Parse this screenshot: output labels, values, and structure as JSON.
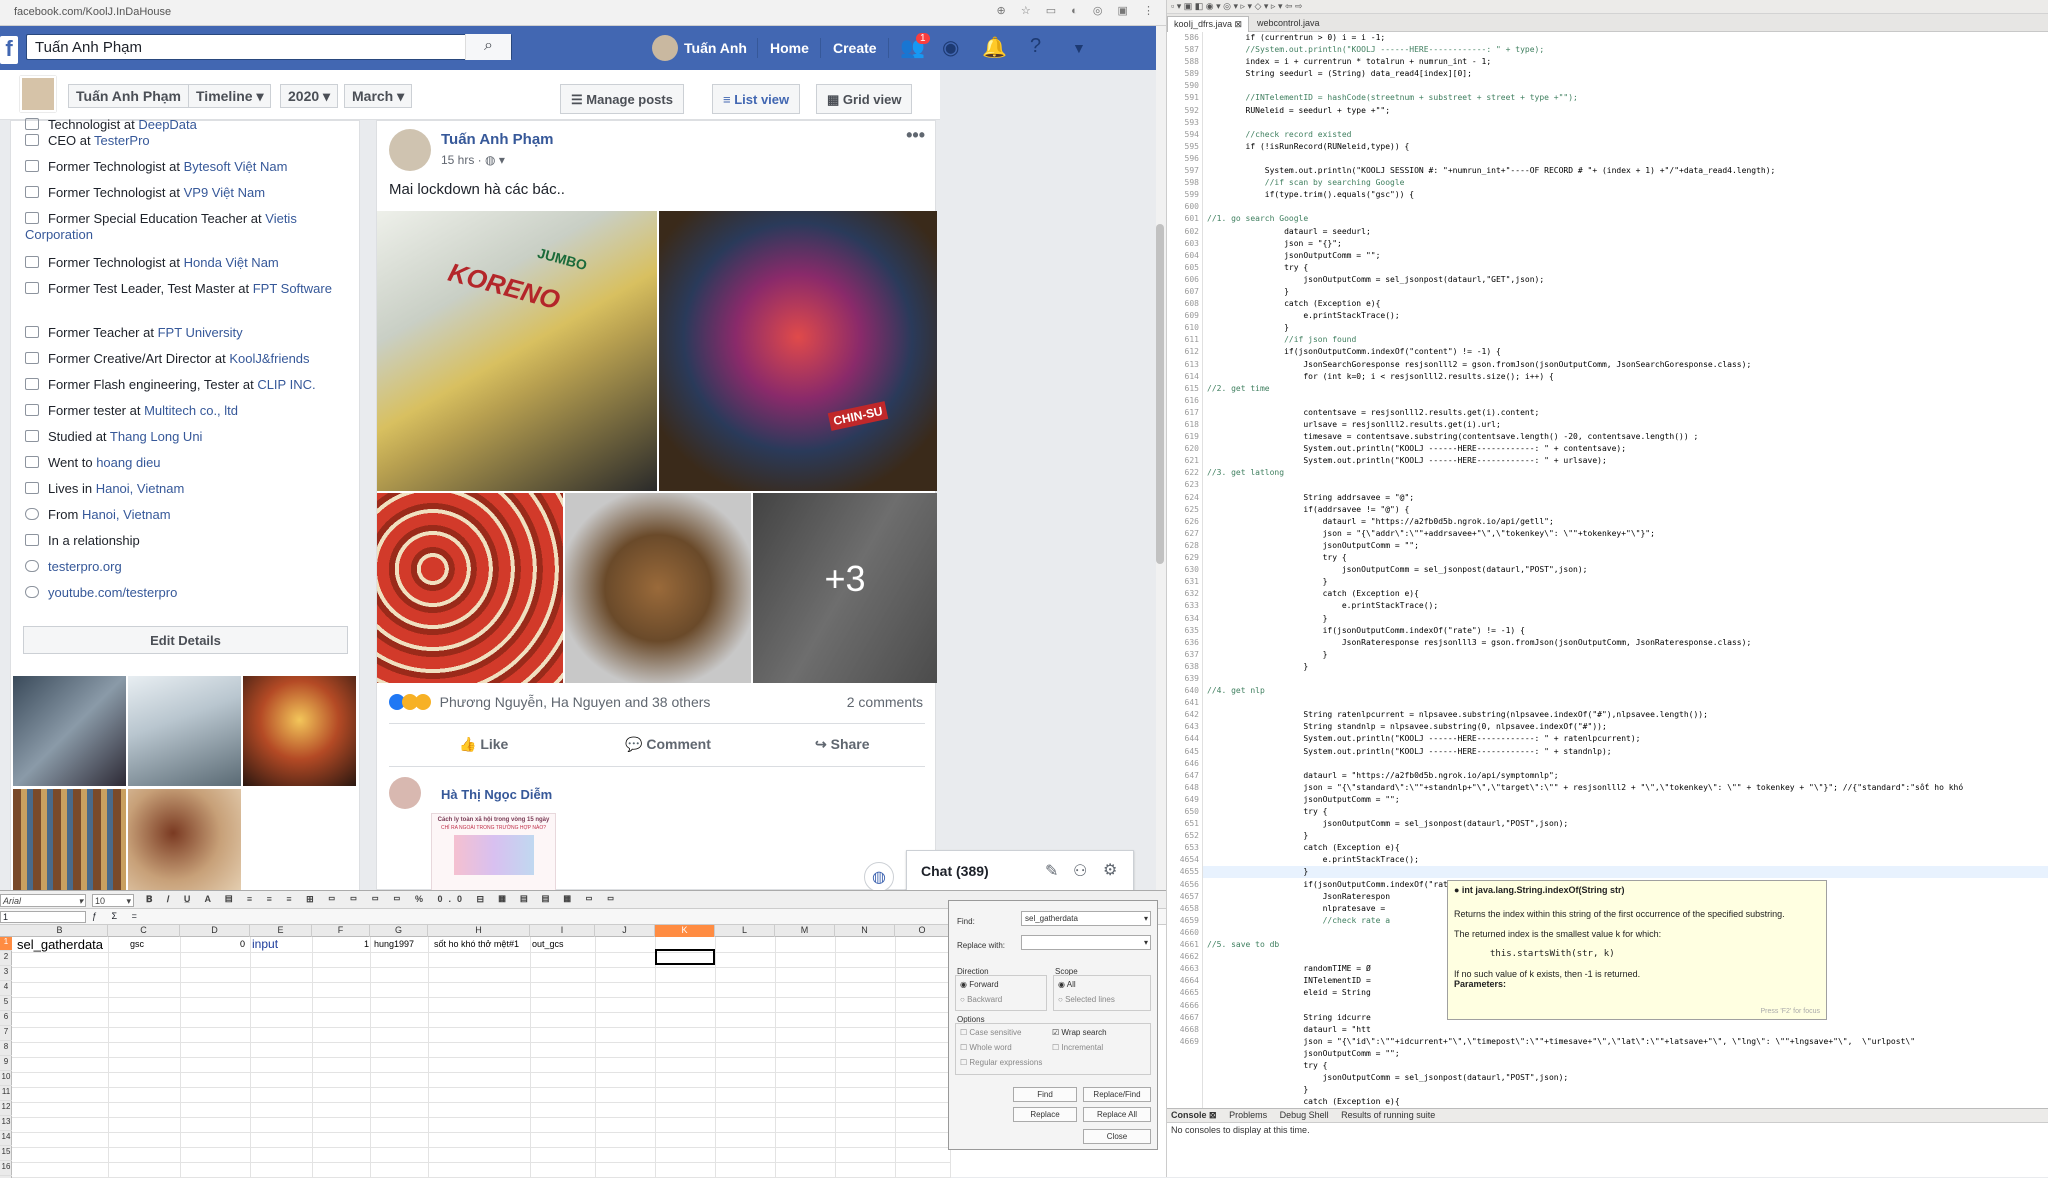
{
  "browser": {
    "url": "facebook.com/KoolJ.InDaHouse"
  },
  "topnav": {
    "search_value": "Tuấn Anh Phạm",
    "profile_name": "Tuấn Anh",
    "home": "Home",
    "create": "Create",
    "friend_badge": "1",
    "brand_color": "#4267b2"
  },
  "timeline_bar": {
    "name": "Tuấn Anh Phạm",
    "timeline": "Timeline",
    "year": "2020",
    "month": "March",
    "manage_posts": "Manage posts",
    "list_view": "List view",
    "grid_view": "Grid view"
  },
  "intro": {
    "cut_top": {
      "prefix": "Technologist at ",
      "link": "DeepData"
    },
    "items": [
      {
        "icon": "briefcase-icon",
        "prefix": "CEO at ",
        "link": "TesterPro"
      },
      {
        "icon": "briefcase-icon",
        "prefix": "Former Technologist at ",
        "link": "Bytesoft Việt Nam"
      },
      {
        "icon": "briefcase-icon",
        "prefix": "Former Technologist at ",
        "link": "VP9 Việt Nam"
      },
      {
        "icon": "briefcase-icon",
        "prefix": "Former Special Education Teacher at ",
        "link": "Vietis Corporation"
      },
      {
        "icon": "briefcase-icon",
        "prefix": "Former Technologist at ",
        "link": "Honda Việt Nam"
      },
      {
        "icon": "briefcase-icon",
        "prefix": "Former Test Leader, Test Master at ",
        "link": "FPT Software"
      },
      {
        "icon": "briefcase-icon",
        "prefix": "Former Teacher at ",
        "link": "FPT University"
      },
      {
        "icon": "briefcase-icon",
        "prefix": "Former Creative/Art Director at ",
        "link": "KoolJ&friends"
      },
      {
        "icon": "briefcase-icon",
        "prefix": "Former Flash engineering, Tester at ",
        "link": "CLIP INC."
      },
      {
        "icon": "briefcase-icon",
        "prefix": "Former tester at ",
        "link": "Multitech co., ltd"
      },
      {
        "icon": "graduation-cap-icon",
        "prefix": "Studied at ",
        "link": "Thang Long Uni"
      },
      {
        "icon": "graduation-cap-icon",
        "prefix": "Went to ",
        "link": "hoang dieu"
      },
      {
        "icon": "home-icon",
        "prefix": "Lives in ",
        "link": "Hanoi, Vietnam"
      },
      {
        "icon": "location-pin-icon",
        "prefix": "From ",
        "link": "Hanoi, Vietnam"
      },
      {
        "icon": "heart-icon",
        "prefix": "In a relationship",
        "link": ""
      },
      {
        "icon": "globe-icon",
        "prefix": "",
        "link": "testerpro.org"
      },
      {
        "icon": "globe-icon",
        "prefix": "",
        "link": "youtube.com/testerpro"
      }
    ],
    "edit_details": "Edit Details"
  },
  "post": {
    "author": "Tuấn Anh Phạm",
    "time": "15 hrs · ",
    "text": "Mai lockdown hà các bác..",
    "more_photos": "+3",
    "reactions": "Phương Nguyễn, Ha Nguyen and 38 others",
    "comments": "2 comments",
    "like": "Like",
    "comment": "Comment",
    "share": "Share",
    "comment_author": "Hà Thị Ngọc Diễm",
    "comment_card_title": "Cách ly toàn xã hội trong vòng 15 ngày",
    "comment_card_sub": "CHỈ RA NGOÀI TRONG TRƯỜNG HỢP NÀO?",
    "photo_labels": [
      "JUMBO",
      "KORENO",
      "CHIN-SU"
    ]
  },
  "chat": {
    "label": "Chat (389)"
  },
  "ide": {
    "toolbar": "▫ ▾ ▣ ◧ ◉ ▾ ◎ ▾ ▹ ▾ ◇ ▾ ▹ ▾ ⇦ ⇨",
    "tabs": [
      "kooIj_dfrs.java ⊠",
      "webcontrol.java"
    ],
    "line_numbers": [
      "586",
      "587",
      "588",
      "589",
      "590",
      "591",
      "592",
      "593",
      "594",
      "595",
      "596",
      "597",
      "598",
      "599",
      "600",
      "601",
      "602",
      "603",
      "604",
      "605",
      "606",
      "607",
      "608",
      "609",
      "610",
      "611",
      "612",
      "613",
      "614",
      "615",
      "616",
      "617",
      "618",
      "619",
      "620",
      "621",
      "622",
      "623",
      "624",
      "625",
      "626",
      "627",
      "628",
      "629",
      "630",
      "631",
      "632",
      "633",
      "634",
      "635",
      "636",
      "637",
      "638",
      "639",
      "640",
      "641",
      "642",
      "643",
      "644",
      "645",
      "646",
      "647",
      "648",
      "649",
      "650",
      "651",
      "652",
      "653",
      "4654",
      "4655",
      "4656",
      "4657",
      "4658",
      "4659",
      "4660",
      "4661",
      "4662",
      "4663",
      "4664",
      "4665",
      "4666",
      "4667",
      "4668",
      "4669"
    ],
    "code_lines": [
      {
        "t": "        if (currentrun > 0) i = i -1;",
        "c": ""
      },
      {
        "t": "        //System.out.println(\"KOOLJ ------HERE------------: \" + type);",
        "c": "cm"
      },
      {
        "t": "        index = i + currentrun * totalrun + numrun_int - 1;",
        "c": ""
      },
      {
        "t": "        String seedurl = (String) data_read4[index][0];",
        "c": ""
      },
      {
        "t": "",
        "c": ""
      },
      {
        "t": "        //INTelementID = hashCode(streetnum + substreet + street + type +\"\");",
        "c": "cm"
      },
      {
        "t": "        RUNeleid = seedurl + type +\"\";",
        "c": ""
      },
      {
        "t": "",
        "c": ""
      },
      {
        "t": "        //check record existed",
        "c": "cm"
      },
      {
        "t": "        if (!isRunRecord(RUNeleid,type)) {",
        "c": ""
      },
      {
        "t": "",
        "c": ""
      },
      {
        "t": "            System.out.println(\"KOOLJ SESSION #: \"+numrun_int+\"----OF RECORD # \"+ (index + 1) +\"/\"+data_read4.length);",
        "c": ""
      },
      {
        "t": "            //if scan by searching Google",
        "c": "cm"
      },
      {
        "t": "            if(type.trim().equals(\"gsc\")) {",
        "c": ""
      },
      {
        "t": "",
        "c": ""
      },
      {
        "t": "//1. go search Google",
        "c": "cm"
      },
      {
        "t": "                dataurl = seedurl;",
        "c": ""
      },
      {
        "t": "                json = \"{}\";",
        "c": ""
      },
      {
        "t": "                jsonOutputComm = \"\";",
        "c": ""
      },
      {
        "t": "                try {",
        "c": ""
      },
      {
        "t": "                    jsonOutputComm = sel_jsonpost(dataurl,\"GET\",json);",
        "c": ""
      },
      {
        "t": "                }",
        "c": ""
      },
      {
        "t": "                catch (Exception e){",
        "c": ""
      },
      {
        "t": "                    e.printStackTrace();",
        "c": ""
      },
      {
        "t": "                }",
        "c": ""
      },
      {
        "t": "                //if json found",
        "c": "cm"
      },
      {
        "t": "                if(jsonOutputComm.indexOf(\"content\") != -1) {",
        "c": ""
      },
      {
        "t": "                    JsonSearchGoresponse resjsonlll2 = gson.fromJson(jsonOutputComm, JsonSearchGoresponse.class);",
        "c": ""
      },
      {
        "t": "                    for (int k=0; i < resjsonlll2.results.size(); i++) {",
        "c": ""
      },
      {
        "t": "//2. get time",
        "c": "cm"
      },
      {
        "t": "",
        "c": ""
      },
      {
        "t": "                    contentsave = resjsonlll2.results.get(i).content;",
        "c": ""
      },
      {
        "t": "                    urlsave = resjsonlll2.results.get(i).url;",
        "c": ""
      },
      {
        "t": "                    timesave = contentsave.substring(contentsave.length() -20, contentsave.length()) ;",
        "c": ""
      },
      {
        "t": "                    System.out.println(\"KOOLJ ------HERE------------: \" + contentsave);",
        "c": ""
      },
      {
        "t": "                    System.out.println(\"KOOLJ ------HERE------------: \" + urlsave);",
        "c": ""
      },
      {
        "t": "//3. get latlong",
        "c": "cm"
      },
      {
        "t": "",
        "c": ""
      },
      {
        "t": "                    String addrsavee = \"@\";",
        "c": ""
      },
      {
        "t": "                    if(addrsavee != \"@\") {",
        "c": ""
      },
      {
        "t": "                        dataurl = \"https://a2fb0d5b.ngrok.io/api/getll\";",
        "c": ""
      },
      {
        "t": "                        json = \"{\\\"addr\\\":\\\"\"+addrsavee+\"\\\",\\\"tokenkey\\\": \\\"\"+tokenkey+\"\\\"}\";",
        "c": ""
      },
      {
        "t": "                        jsonOutputComm = \"\";",
        "c": ""
      },
      {
        "t": "                        try {",
        "c": ""
      },
      {
        "t": "                            jsonOutputComm = sel_jsonpost(dataurl,\"POST\",json);",
        "c": ""
      },
      {
        "t": "                        }",
        "c": ""
      },
      {
        "t": "                        catch (Exception e){",
        "c": ""
      },
      {
        "t": "                            e.printStackTrace();",
        "c": ""
      },
      {
        "t": "                        }",
        "c": ""
      },
      {
        "t": "                        if(jsonOutputComm.indexOf(\"rate\") != -1) {",
        "c": ""
      },
      {
        "t": "                            JsonRateresponse resjsonlll3 = gson.fromJson(jsonOutputComm, JsonRateresponse.class);",
        "c": ""
      },
      {
        "t": "                        }",
        "c": ""
      },
      {
        "t": "                    }",
        "c": ""
      },
      {
        "t": "",
        "c": ""
      },
      {
        "t": "//4. get nlp",
        "c": "cm"
      },
      {
        "t": "",
        "c": ""
      },
      {
        "t": "                    String ratenlpcurrent = nlpsavee.substring(nlpsavee.indexOf(\"#\"),nlpsavee.length());",
        "c": ""
      },
      {
        "t": "                    String standnlp = nlpsavee.substring(0, nlpsavee.indexOf(\"#\"));",
        "c": ""
      },
      {
        "t": "                    System.out.println(\"KOOLJ ------HERE------------: \" + ratenlpcurrent);",
        "c": ""
      },
      {
        "t": "                    System.out.println(\"KOOLJ ------HERE------------: \" + standnlp);",
        "c": ""
      },
      {
        "t": "",
        "c": ""
      },
      {
        "t": "                    dataurl = \"https://a2fb0d5b.ngrok.io/api/symptomnlp\";",
        "c": ""
      },
      {
        "t": "                    json = \"{\\\"standard\\\":\\\"\"+standnlp+\"\\\",\\\"target\\\":\\\"\" + resjsonlll2 + \"\\\",\\\"tokenkey\\\": \\\"\" + tokenkey + \"\\\"}\"; //{\"standard\":\"sốt ho khó",
        "c": ""
      },
      {
        "t": "                    jsonOutputComm = \"\";",
        "c": ""
      },
      {
        "t": "                    try {",
        "c": ""
      },
      {
        "t": "                        jsonOutputComm = sel_jsonpost(dataurl,\"POST\",json);",
        "c": ""
      },
      {
        "t": "                    }",
        "c": ""
      },
      {
        "t": "                    catch (Exception e){",
        "c": ""
      },
      {
        "t": "                        e.printStackTrace();",
        "c": ""
      },
      {
        "t": "                    }",
        "c": ""
      },
      {
        "t": "                    if(jsonOutputComm.indexOf(\"rate\") != -1) {",
        "c": ""
      },
      {
        "t": "                        JsonRaterespon",
        "c": ""
      },
      {
        "t": "                        nlpratesave =",
        "c": ""
      },
      {
        "t": "                        //check rate a",
        "c": "cm"
      },
      {
        "t": "",
        "c": ""
      },
      {
        "t": "//5. save to db",
        "c": "cm"
      },
      {
        "t": "",
        "c": ""
      },
      {
        "t": "                    randomTIME = Ø",
        "c": ""
      },
      {
        "t": "                    INTelementID =",
        "c": ""
      },
      {
        "t": "                    eleid = String",
        "c": ""
      },
      {
        "t": "",
        "c": ""
      },
      {
        "t": "                    String idcurre",
        "c": ""
      },
      {
        "t": "                    dataurl = \"htt",
        "c": ""
      },
      {
        "t": "                    json = \"{\\\"id\\\":\\\"\"+idcurrent+\"\\\",\\\"timepost\\\":\\\"\"+timesave+\"\\\",\\\"lat\\\":\\\"\"+latsave+\"\\\", \\\"lng\\\": \\\"\"+lngsave+\"\\\",  \\\"urlpost\\\"",
        "c": ""
      },
      {
        "t": "                    jsonOutputComm = \"\";",
        "c": ""
      },
      {
        "t": "                    try {",
        "c": ""
      },
      {
        "t": "                        jsonOutputComm = sel_jsonpost(dataurl,\"POST\",json);",
        "c": ""
      },
      {
        "t": "                    }",
        "c": ""
      },
      {
        "t": "                    catch (Exception e){",
        "c": ""
      },
      {
        "t": "                        e.printStackTrace();",
        "c": ""
      }
    ],
    "tooltip": {
      "head": "● int java.lang.String.indexOf(String str)",
      "line1": "Returns the index within this string of the first occurrence of the specified substring.",
      "line2": "The returned index is the smallest value k for which:",
      "code": "this.startsWith(str, k)",
      "line3": "If no such value of k exists, then -1 is returned.",
      "params": "Parameters:",
      "foot": "Press 'F2' for focus"
    },
    "console_tabs": [
      "Console ⊠",
      "Problems",
      "Debug Shell",
      "Results of running suite"
    ],
    "console_msg": "No consoles to display at this time."
  },
  "sheet": {
    "font": "Arial",
    "size": "10",
    "namebox": "1",
    "columns": [
      "B",
      "C",
      "D",
      "E",
      "F",
      "G",
      "H",
      "I",
      "J",
      "K",
      "L",
      "M",
      "N",
      "O"
    ],
    "rows": [
      "1",
      "2",
      "3",
      "4",
      "5",
      "6",
      "7",
      "8",
      "9",
      "10",
      "11",
      "12",
      "13",
      "14",
      "15",
      "16"
    ],
    "cells": {
      "b1": "sel_gatherdata",
      "c1": "gsc",
      "d1": "0",
      "e1": "input",
      "f1": "1",
      "g1": "hung1997",
      "h1": "sốt ho khó thở mệt#1",
      "i1": "out_gcs"
    }
  },
  "find": {
    "find_label": "Find:",
    "find_value": "sel_gatherdata",
    "replace_label": "Replace with:",
    "direction": "Direction",
    "forward": "Forward",
    "backward": "Backward",
    "scope": "Scope",
    "all": "All",
    "selected_lines": "Selected lines",
    "options": "Options",
    "case_sensitive": "Case sensitive",
    "wrap_search": "Wrap search",
    "whole_word": "Whole word",
    "incremental": "Incremental",
    "regex": "Regular expressions",
    "btn_find": "Find",
    "btn_replace_find": "Replace/Find",
    "btn_replace": "Replace",
    "btn_replace_all": "Replace All",
    "btn_close": "Close"
  }
}
